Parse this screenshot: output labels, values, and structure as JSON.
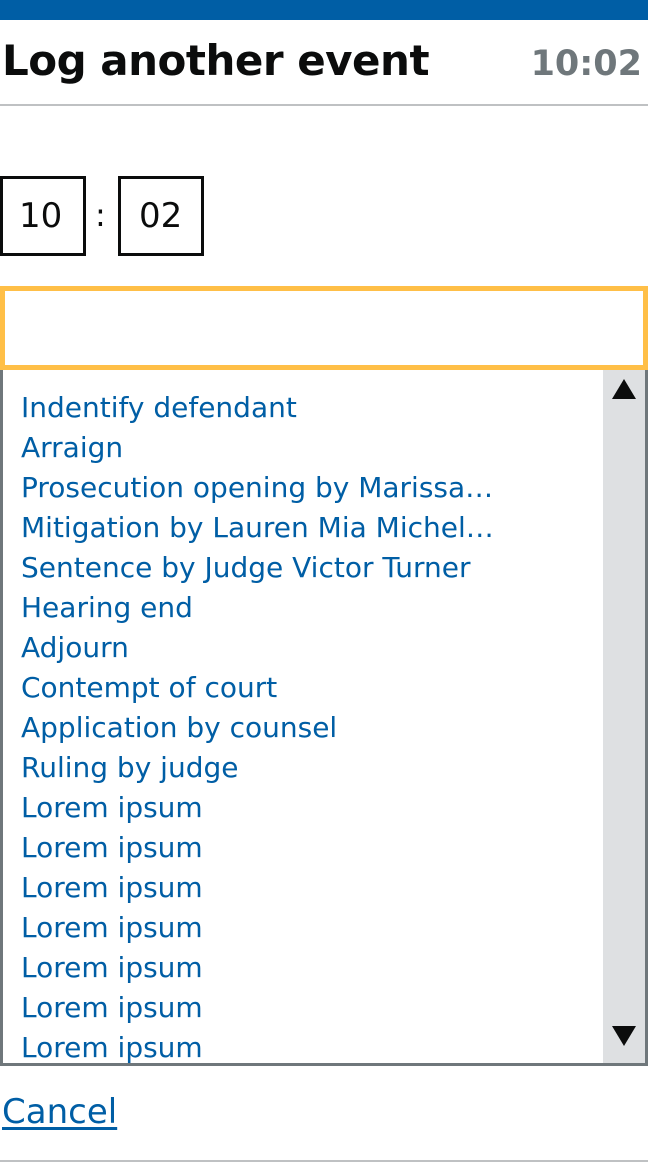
{
  "header": {
    "title": "Log another event",
    "clock": "10:02"
  },
  "time_entry": {
    "hours": "10",
    "separator": ":",
    "minutes": "02"
  },
  "search": {
    "value": "",
    "placeholder": ""
  },
  "event_list": {
    "items": [
      "Indentify defendant",
      "Arraign",
      "Prosecution opening by Marissa…",
      "Mitigation by Lauren Mia Michel…",
      "Sentence by Judge Victor Turner",
      "Hearing end",
      "Adjourn",
      "Contempt of court",
      "Application by counsel",
      "Ruling by judge",
      "Lorem ipsum",
      "Lorem ipsum",
      "Lorem ipsum",
      "Lorem ipsum",
      "Lorem ipsum",
      "Lorem ipsum",
      "Lorem ipsum"
    ],
    "scroll_up_icon": "triangle-up-icon",
    "scroll_down_icon": "triangle-down-icon"
  },
  "footer": {
    "cancel_label": "Cancel"
  },
  "colors": {
    "brand_blue": "#005ea5",
    "focus_yellow": "#ffbf47",
    "text": "#0b0c0c",
    "muted_text": "#6f777b",
    "scrollbar_track": "#dee0e2"
  }
}
